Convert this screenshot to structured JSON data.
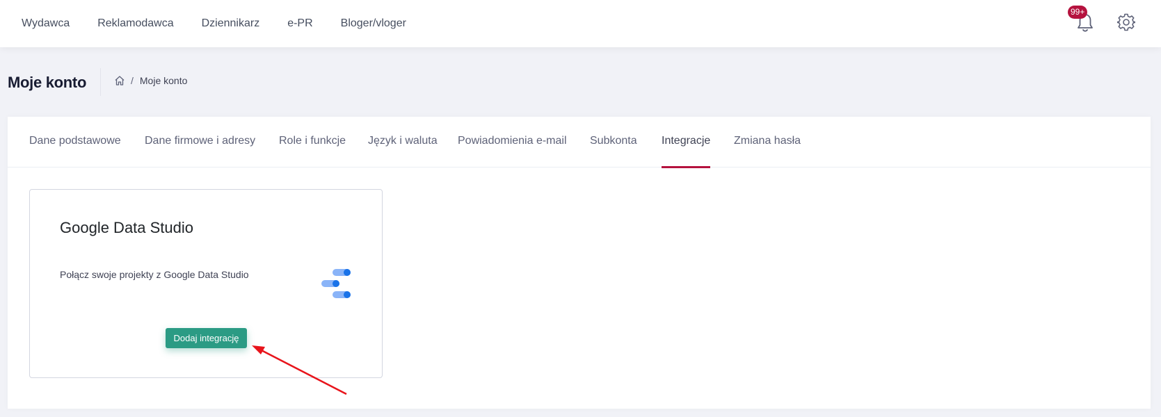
{
  "topnav": {
    "items": [
      "Wydawca",
      "Reklamodawca",
      "Dziennikarz",
      "e-PR",
      "Bloger/vloger"
    ]
  },
  "notifications": {
    "badge": "99+"
  },
  "header": {
    "title": "Moje konto",
    "breadcrumb": {
      "current": "Moje konto",
      "separator": "/"
    }
  },
  "tabs": {
    "items": [
      "Dane podstawowe",
      "Dane firmowe i adresy",
      "Role i funkcje",
      "Język i waluta",
      "Powiadomienia e-mail",
      "Subkonta",
      "Integracje",
      "Zmiana hasła"
    ],
    "active": "Integracje"
  },
  "integration": {
    "title": "Google Data Studio",
    "description": "Połącz swoje projekty z Google Data Studio",
    "button_label": "Dodaj integrację"
  },
  "colors": {
    "accent": "#b5123e",
    "button": "#2b9b84",
    "annotation_arrow": "#e8141b"
  },
  "icons": {
    "home": "home-icon",
    "bell": "bell-icon",
    "gear": "gear-icon",
    "logo": "google-data-studio-logo"
  }
}
